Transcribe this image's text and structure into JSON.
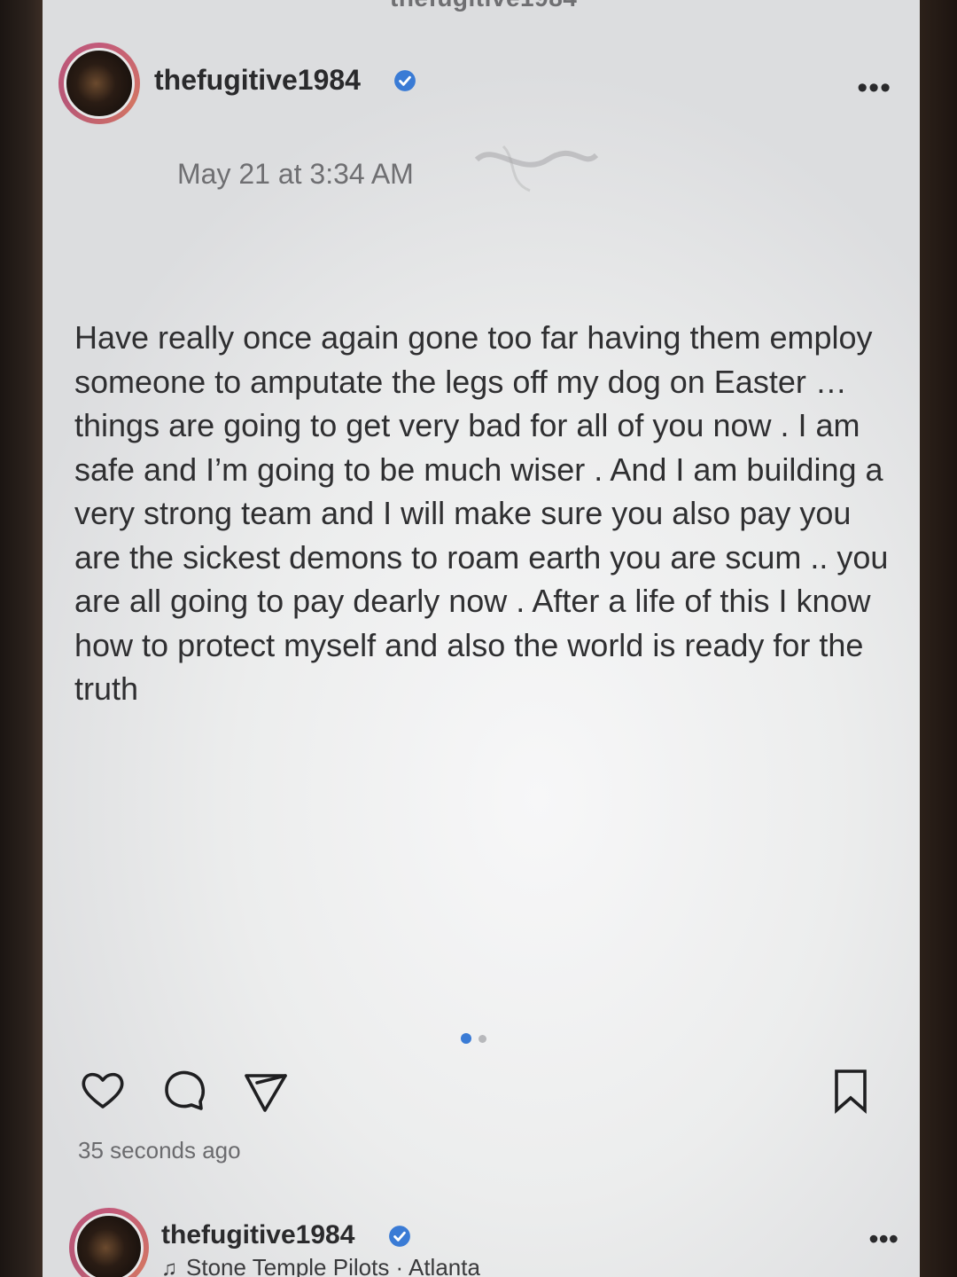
{
  "top_bar": {
    "username": "thefugitive1984"
  },
  "post": {
    "username": "thefugitive1984",
    "verified": true,
    "date": "May 21 at 3:34 AM",
    "text": "Have really once again gone too far having them employ someone to amputate the legs off my dog on Easter … things are going to get very bad for all of you now . I am safe and I’m going to be much wiser . And I am building a very strong team and I will make sure you also pay you are the sickest demons to roam earth you are scum .. you are all going to pay dearly now . After a life of this I know how to protect myself and also the world is ready for the truth",
    "carousel": {
      "current_index": 1,
      "total": 2
    },
    "actions": [
      "heart-icon",
      "comment-icon",
      "share-icon",
      "bookmark-icon"
    ],
    "timestamp": "35 seconds ago"
  },
  "next_post": {
    "username": "thefugitive1984",
    "verified": true,
    "music": "Stone Temple Pilots · Atlanta"
  },
  "colors": {
    "verified_blue": "#3a7bd5",
    "avatar_ring": "#c25a7a"
  }
}
